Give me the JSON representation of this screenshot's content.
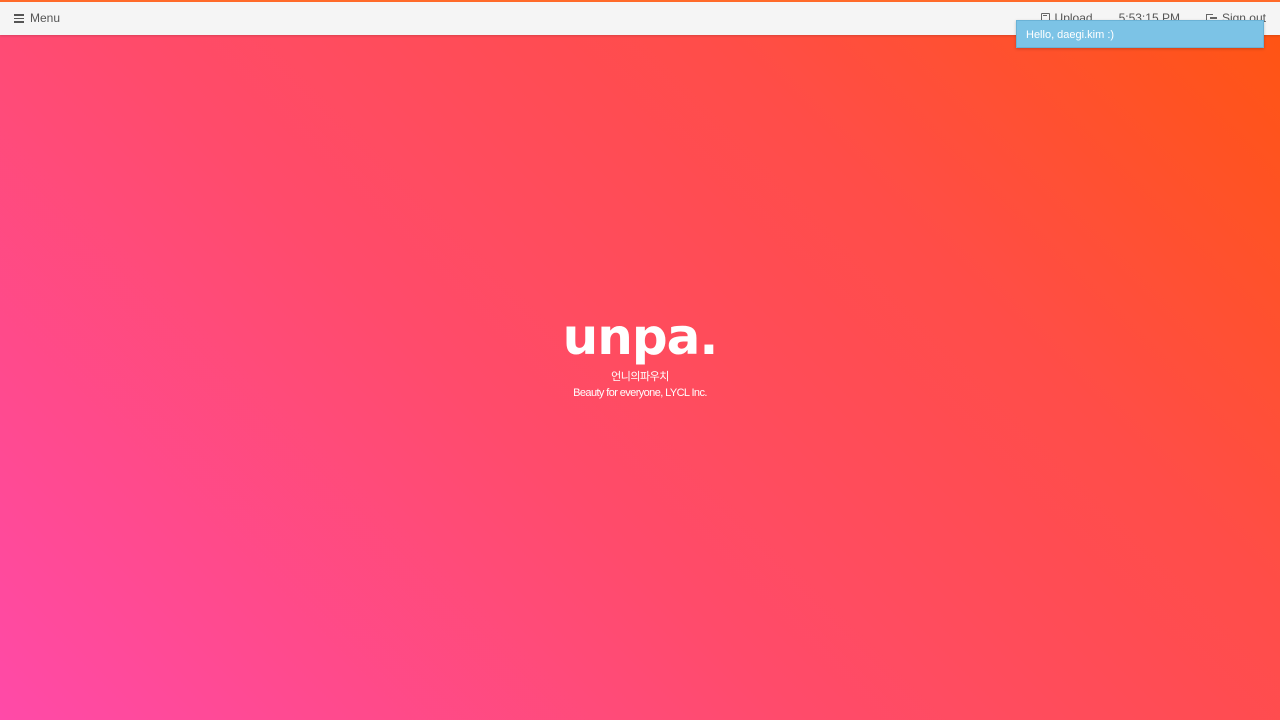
{
  "topbar": {
    "menu_label": "Menu",
    "upload_label": "Upload",
    "clock": "5:53:15 PM",
    "signout_label": "Sign out",
    "accent_color": "#ff6a2a"
  },
  "toast": {
    "message": "Hello, daegi.kim :)",
    "color": "#7cc3e6"
  },
  "brand": {
    "logo_text": "unpa.",
    "korean_name": "언니의파우치",
    "tagline": "Beauty for everyone, LYCL Inc."
  },
  "icons": {
    "menu": "hamburger-icon",
    "upload": "upload-file-icon",
    "signout": "sign-out-icon"
  }
}
